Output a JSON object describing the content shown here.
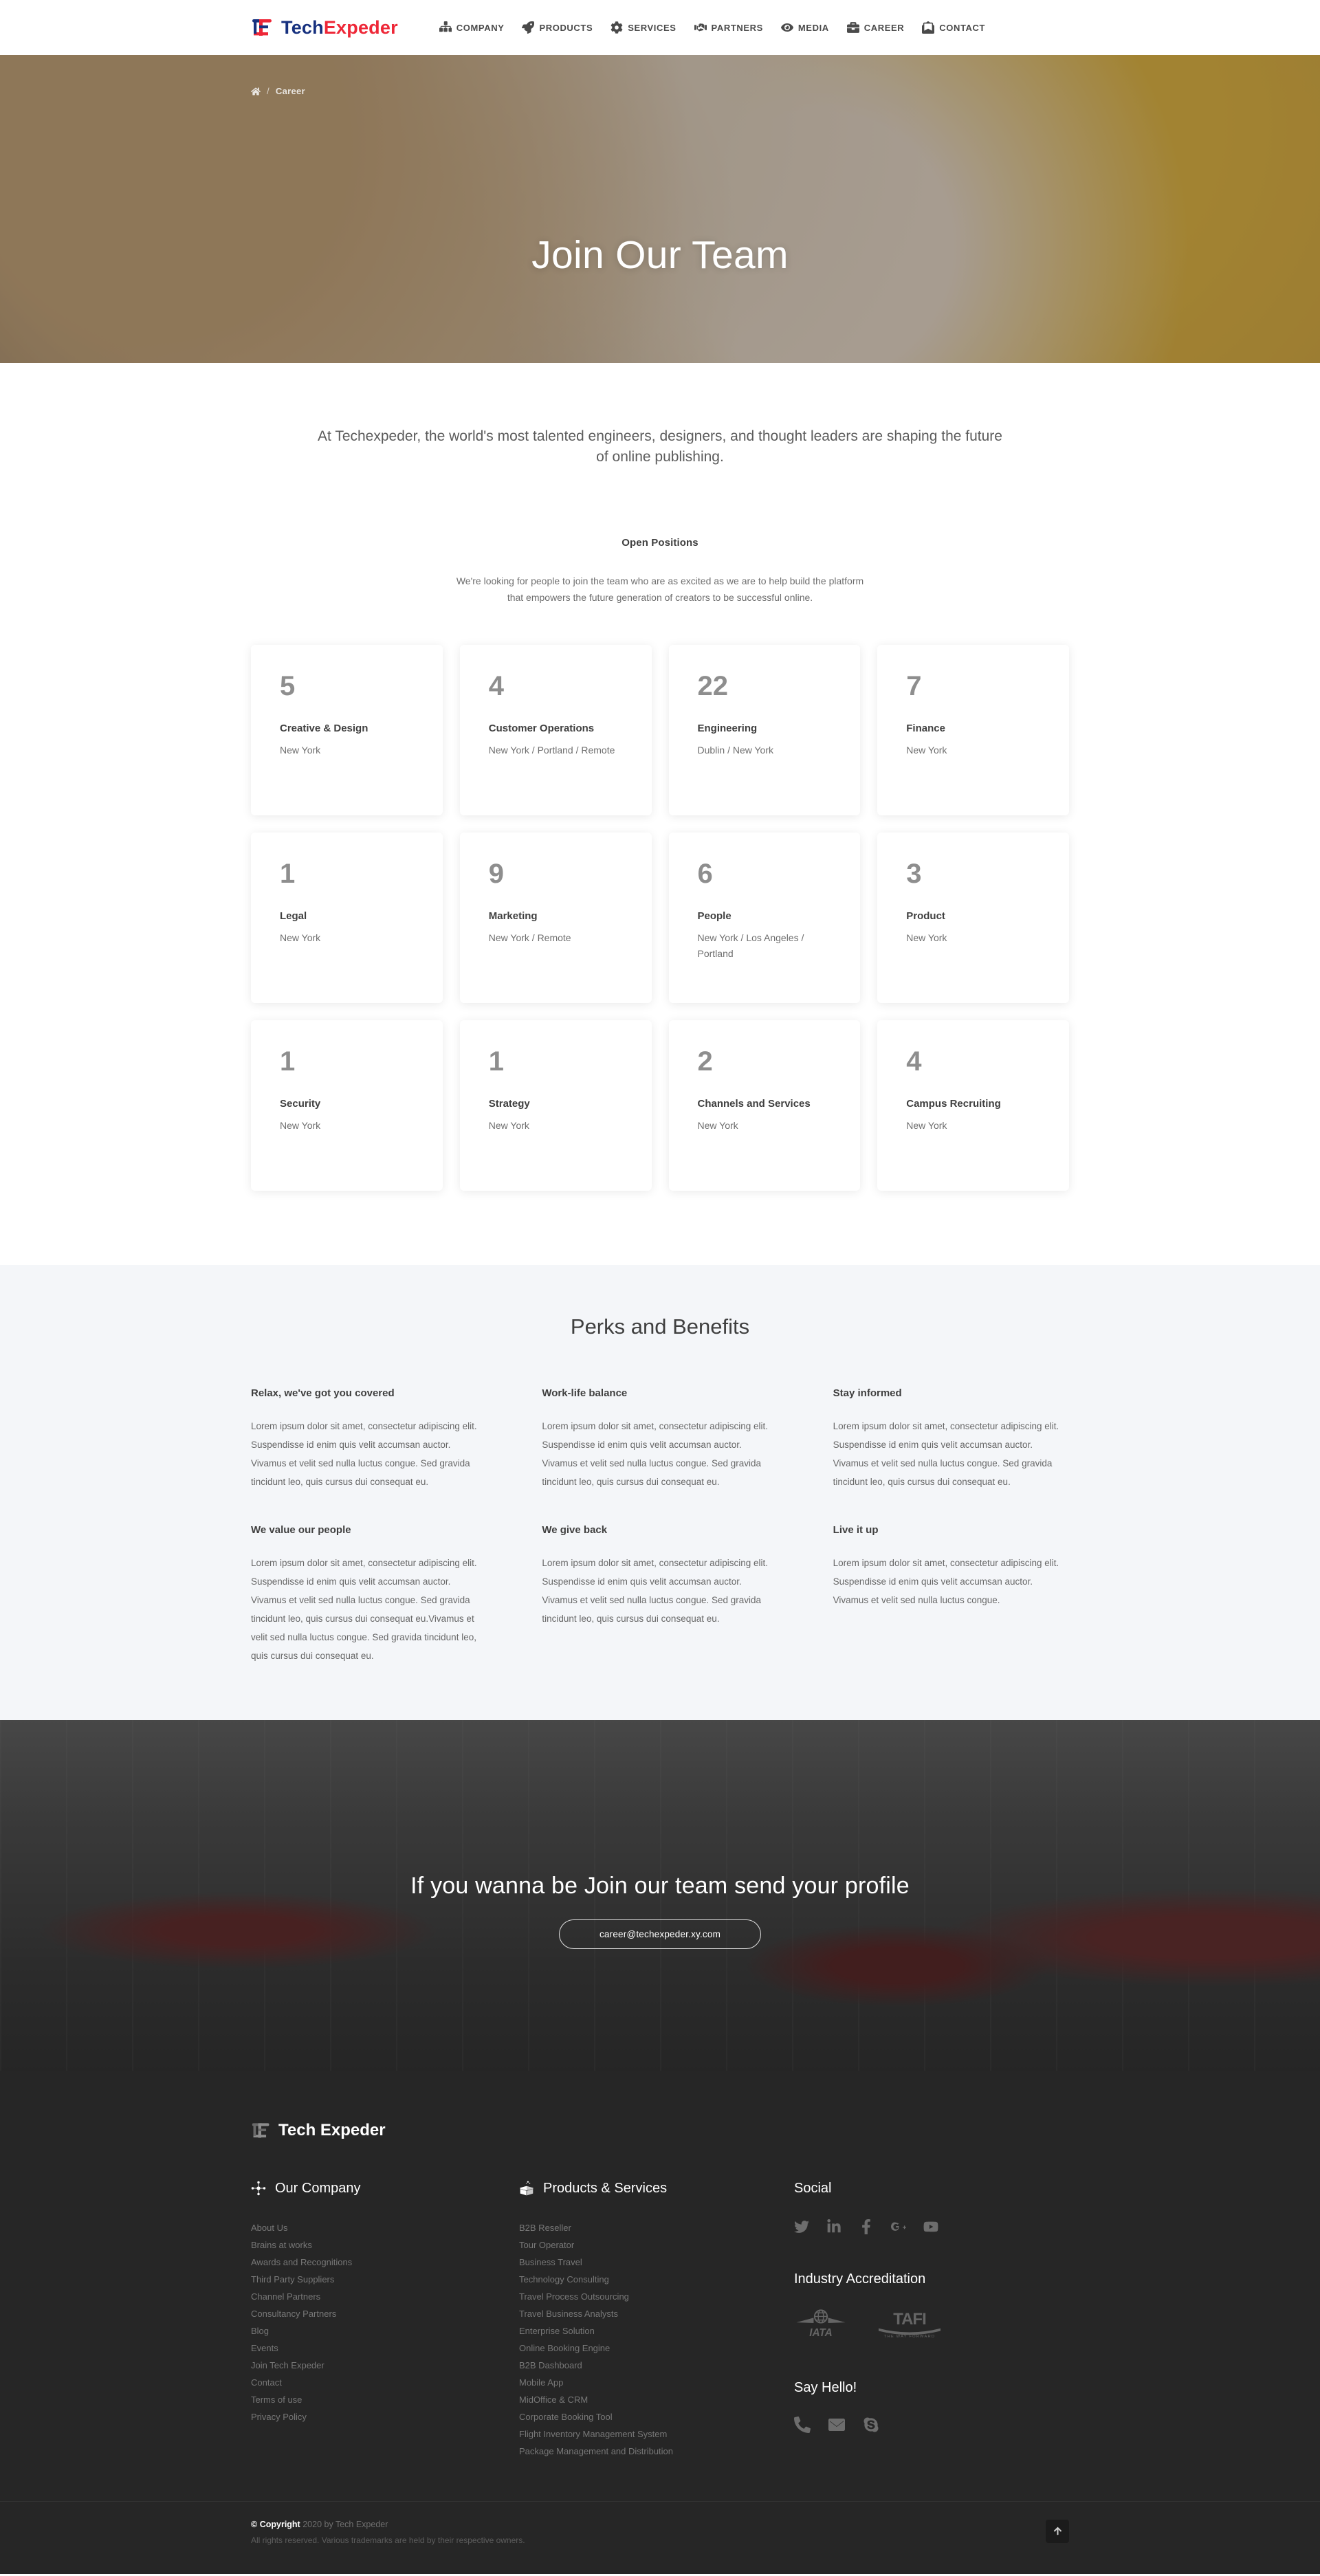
{
  "header": {
    "logo": {
      "part1": "Tech",
      "part2": "Expeder",
      "icon": "techexpeder-logo-icon"
    },
    "nav": [
      {
        "label": "COMPANY",
        "icon": "sitemap-icon"
      },
      {
        "label": "PRODUCTS",
        "icon": "rocket-icon"
      },
      {
        "label": "SERVICES",
        "icon": "gear-icon"
      },
      {
        "label": "PARTNERS",
        "icon": "handshake-icon"
      },
      {
        "label": "MEDIA",
        "icon": "eye-icon"
      },
      {
        "label": "CAREER",
        "icon": "briefcase-icon"
      },
      {
        "label": "CONTACT",
        "icon": "envelope-open-icon"
      }
    ]
  },
  "hero": {
    "breadcrumb": {
      "home_icon": "home-icon",
      "separator": "/",
      "current": "Career"
    },
    "title": "Join Our Team"
  },
  "intro": {
    "lead": "At Techexpeder, the world's most talented engineers, designers, and thought leaders are shaping the future of online publishing.",
    "open_positions_heading": "Open Positions",
    "open_positions_text": "We're looking for people to join the team who are as excited as we are to help build the platform that empowers the future generation of creators to be successful online."
  },
  "jobs": [
    {
      "count": "5",
      "title": "Creative & Design",
      "location": "New York"
    },
    {
      "count": "4",
      "title": "Customer Operations",
      "location": "New York / Portland / Remote"
    },
    {
      "count": "22",
      "title": "Engineering",
      "location": "Dublin / New York"
    },
    {
      "count": "7",
      "title": "Finance",
      "location": "New York"
    },
    {
      "count": "1",
      "title": "Legal",
      "location": "New York"
    },
    {
      "count": "9",
      "title": "Marketing",
      "location": "New York / Remote"
    },
    {
      "count": "6",
      "title": "People",
      "location": "New York / Los Angeles / Portland"
    },
    {
      "count": "3",
      "title": "Product",
      "location": "New York"
    },
    {
      "count": "1",
      "title": "Security",
      "location": "New York"
    },
    {
      "count": "1",
      "title": "Strategy",
      "location": "New York"
    },
    {
      "count": "2",
      "title": "Channels and Services",
      "location": "New York"
    },
    {
      "count": "4",
      "title": "Campus Recruiting",
      "location": "New York"
    }
  ],
  "perks": {
    "title": "Perks and Benefits",
    "items": [
      {
        "heading": "Relax, we've got you covered",
        "body": "Lorem ipsum dolor sit amet, consectetur adipiscing elit. Suspendisse id enim quis velit accumsan auctor. Vivamus et velit sed nulla luctus congue. Sed gravida tincidunt leo, quis cursus dui consequat eu."
      },
      {
        "heading": "Work-life balance",
        "body": "Lorem ipsum dolor sit amet, consectetur adipiscing elit. Suspendisse id enim quis velit accumsan auctor. Vivamus et velit sed nulla luctus congue. Sed gravida tincidunt leo, quis cursus dui consequat eu."
      },
      {
        "heading": "Stay informed",
        "body": "Lorem ipsum dolor sit amet, consectetur adipiscing elit. Suspendisse id enim quis velit accumsan auctor. Vivamus et velit sed nulla luctus congue. Sed gravida tincidunt leo, quis cursus dui consequat eu."
      },
      {
        "heading": "We value our people",
        "body": "Lorem ipsum dolor sit amet, consectetur adipiscing elit. Suspendisse id enim quis velit accumsan auctor. Vivamus et velit sed nulla luctus congue. Sed gravida tincidunt leo, quis cursus dui consequat eu.Vivamus et velit sed nulla luctus congue. Sed gravida tincidunt leo, quis cursus dui consequat eu."
      },
      {
        "heading": "We give back",
        "body": "Lorem ipsum dolor sit amet, consectetur adipiscing elit. Suspendisse id enim quis velit accumsan auctor. Vivamus et velit sed nulla luctus congue. Sed gravida tincidunt leo, quis cursus dui consequat eu."
      },
      {
        "heading": "Live it up",
        "body": "Lorem ipsum dolor sit amet, consectetur adipiscing elit. Suspendisse id enim quis velit accumsan auctor. Vivamus et velit sed nulla luctus congue."
      }
    ]
  },
  "cta": {
    "title": "If you wanna be Join our team send your profile",
    "button_label": "career@techexpeder.xy.com"
  },
  "footer": {
    "logo": {
      "text": "Tech Expeder",
      "icon": "techexpeder-logo-icon"
    },
    "company": {
      "heading": "Our Company",
      "icon": "network-nodes-icon",
      "links": [
        "About Us",
        "Brains at works",
        "Awards and Recognitions",
        "Third Party Suppliers",
        "Channel Partners",
        "Consultancy Partners",
        "Blog",
        "Events",
        "Join Tech Expeder",
        "Contact",
        "Terms of use",
        "Privacy Policy"
      ]
    },
    "products": {
      "heading": "Products & Services",
      "icon": "open-box-icon",
      "links": [
        "B2B Reseller",
        "Tour Operator",
        "Business Travel",
        "Technology Consulting",
        "Travel Process Outsourcing",
        "Travel Business Analysts",
        "Enterprise Solution",
        "Online Booking Engine",
        "B2B Dashboard",
        "Mobile App",
        "MidOffice & CRM",
        "Corporate Booking Tool",
        "Flight Inventory Management System",
        "Package Management and Distribution"
      ]
    },
    "social": {
      "heading": "Social",
      "icons": [
        "twitter-icon",
        "linkedin-icon",
        "facebook-icon",
        "google-plus-icon",
        "youtube-icon"
      ]
    },
    "accreditation": {
      "heading": "Industry Accreditation",
      "logos": [
        {
          "name": "iata-logo",
          "label": "IATA"
        },
        {
          "name": "tafi-logo",
          "label": "TAFI",
          "tagline": "THE WAY FORWARD"
        }
      ]
    },
    "hello": {
      "heading": "Say Hello!",
      "icons": [
        "phone-icon",
        "mail-icon",
        "skype-icon"
      ]
    },
    "bottom": {
      "copyright_symbol": "©",
      "copyright_word": "Copyright",
      "copyright_rest": "2020 by Tech Expeder",
      "rights": "All rights reserved. Various trademarks are held by their respective owners.",
      "to_top_icon": "arrow-up-icon"
    }
  },
  "colors": {
    "brand_navy": "#17317f",
    "brand_red": "#ee2737",
    "perks_bg": "#f4f6f9",
    "footer_bg": "#262626"
  }
}
